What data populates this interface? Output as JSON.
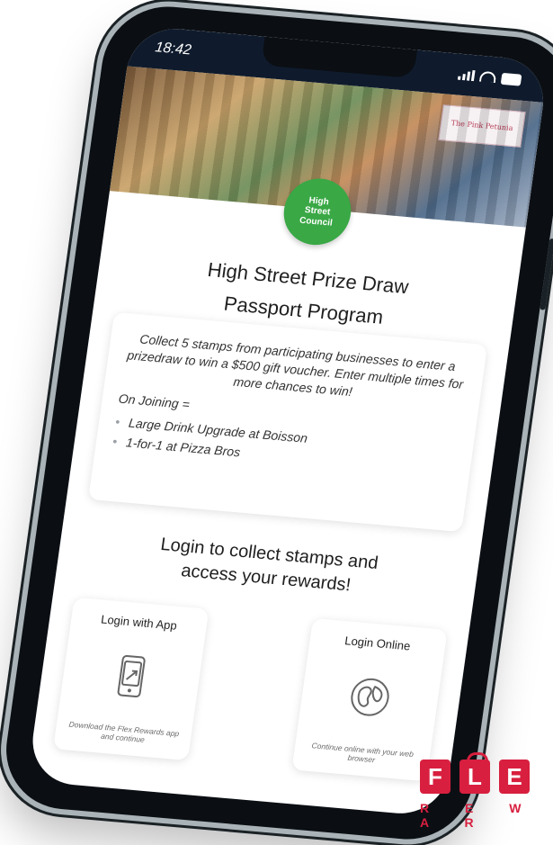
{
  "status_bar": {
    "time": "18:42"
  },
  "hero": {
    "sign_text": "The Pink Petunia",
    "seal": {
      "line1": "High",
      "line2": "Street",
      "line3": "Council"
    }
  },
  "program": {
    "title_line1": "High Street Prize Draw",
    "title_line2": "Passport Program"
  },
  "info_card": {
    "description": "Collect 5 stamps from participating businesses to enter a prizedraw to win a $500 gift voucher. Enter multiple times for more chances to win!",
    "joining_label": "On Joining =",
    "perks": [
      "Large Drink Upgrade at Boisson",
      "1-for-1 at Pizza Bros"
    ]
  },
  "login": {
    "heading_line1": "Login to collect stamps and",
    "heading_line2": "access your rewards!",
    "cards": [
      {
        "title": "Login with App",
        "icon": "phone-icon",
        "description": "Download the Flex Rewards app and continue"
      },
      {
        "title": "Login Online",
        "icon": "globe-icon",
        "description": "Continue online with your web browser"
      }
    ]
  },
  "brand_logo": {
    "letters": [
      "F",
      "L",
      "E"
    ],
    "subtitle": "R E W A R"
  },
  "colors": {
    "status_bar_bg": "#0f1b2d",
    "seal_green": "#39a845",
    "brand_red": "#d81f3f"
  }
}
